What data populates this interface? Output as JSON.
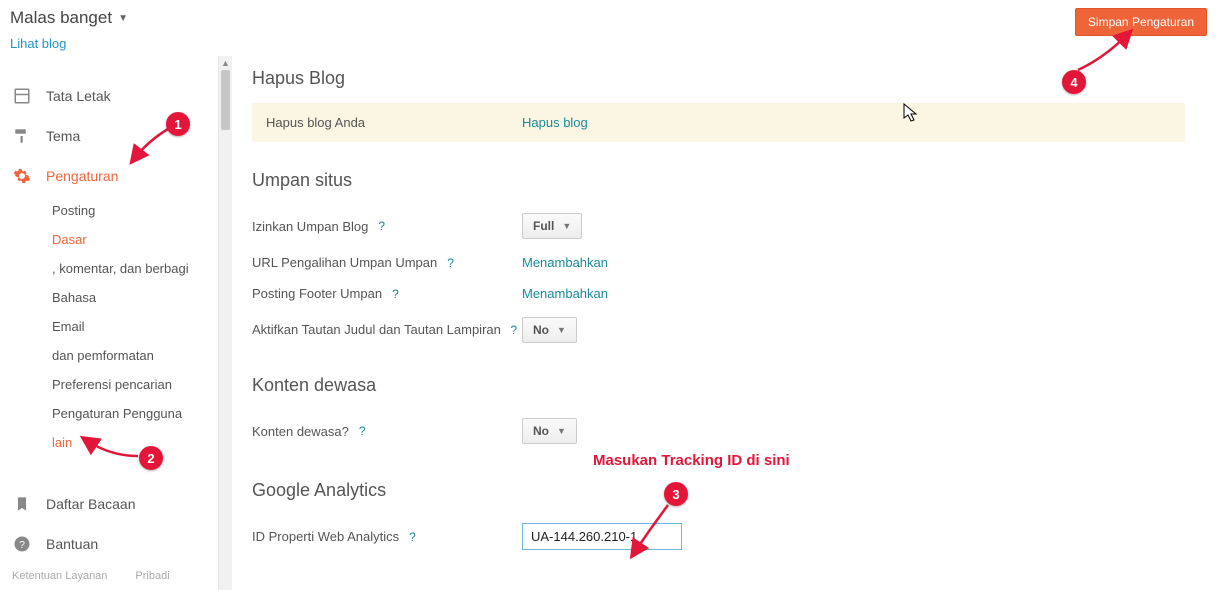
{
  "header": {
    "blog_title": "Malas banget",
    "view_blog": "Lihat blog",
    "save_btn": "Simpan Pengaturan"
  },
  "sidebar": {
    "items": [
      {
        "label": "Tata Letak"
      },
      {
        "label": "Tema"
      },
      {
        "label": "Pengaturan"
      }
    ],
    "sub_items": [
      {
        "label": "Posting"
      },
      {
        "label": "Dasar"
      },
      {
        "label": ", komentar, dan berbagi"
      },
      {
        "label": "Bahasa"
      },
      {
        "label": "Email"
      },
      {
        "label": "dan pemformatan"
      },
      {
        "label": "Preferensi pencarian"
      },
      {
        "label": "Pengaturan Pengguna"
      },
      {
        "label": "lain"
      }
    ],
    "footer": [
      {
        "label": "Daftar Bacaan"
      },
      {
        "label": "Bantuan"
      }
    ],
    "terms": "Ketentuan Layanan",
    "privacy": "Pribadi"
  },
  "main": {
    "hapus": {
      "title": "Hapus Blog",
      "row_label": "Hapus blog Anda",
      "row_link": "Hapus blog"
    },
    "umpan": {
      "title": "Umpan situs",
      "izinkan_label": "Izinkan Umpan Blog",
      "izinkan_val": "Full",
      "url_label": "URL Pengalihan Umpan Umpan",
      "url_val": "Menambahkan",
      "footer_label": "Posting Footer Umpan",
      "footer_val": "Menambahkan",
      "tautan_label": "Aktifkan Tautan Judul dan Tautan Lampiran",
      "tautan_val": "No"
    },
    "dewasa": {
      "title": "Konten dewasa",
      "label": "Konten dewasa?",
      "val": "No"
    },
    "ga": {
      "title": "Google Analytics",
      "label": "ID Properti Web Analytics",
      "val": "UA-144.260.210-1"
    },
    "help": "?"
  },
  "annotations": {
    "b1": "1",
    "b2": "2",
    "b3": "3",
    "b4": "4",
    "tracking_text": "Masukan Tracking ID di sini"
  }
}
